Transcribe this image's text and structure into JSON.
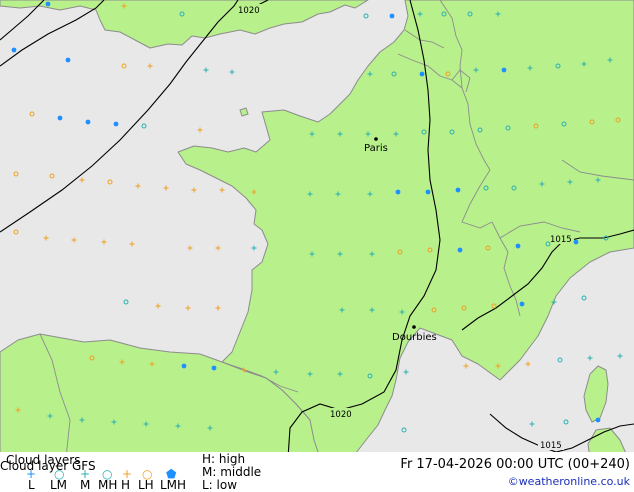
{
  "map": {
    "places": [
      {
        "name": "Paris"
      },
      {
        "name": "Dourbies"
      }
    ],
    "isobars": [
      {
        "label": "1020"
      },
      {
        "label": "1015"
      },
      {
        "label": "1020"
      },
      {
        "label": "1015"
      }
    ],
    "colors": {
      "land": "#b8f08c",
      "sea": "#e8e8e8",
      "coast": "#8c8c8c",
      "isobar": "#000000",
      "low": "#1e90ff",
      "middle": "#2ab0b0",
      "high": "#f0a020"
    }
  },
  "legend": {
    "title": "Cloud layers",
    "subtitle": "Cloud layer GFS",
    "symbols": [
      {
        "label": "L",
        "icon": "plus-icon",
        "color": "#1e90ff"
      },
      {
        "label": "LM",
        "icon": "ring-icon",
        "color": "#2ab0b0"
      },
      {
        "label": "M",
        "icon": "plus-icon",
        "color": "#2ab0b0"
      },
      {
        "label": "MH",
        "icon": "ring-icon",
        "color": "#2ab0b0"
      },
      {
        "label": "H",
        "icon": "plus-icon",
        "color": "#f0a020"
      },
      {
        "label": "LH",
        "icon": "ring-icon",
        "color": "#f0a020"
      },
      {
        "label": "LMH",
        "icon": "filled-blob-icon",
        "color": "#1e90ff"
      }
    ],
    "key": [
      "H: high",
      "M: middle",
      "L: low"
    ]
  },
  "footer": {
    "datetime": "Fr 17-04-2026 00:00 UTC (00+240)",
    "credit": "©weatheronline.co.uk"
  }
}
